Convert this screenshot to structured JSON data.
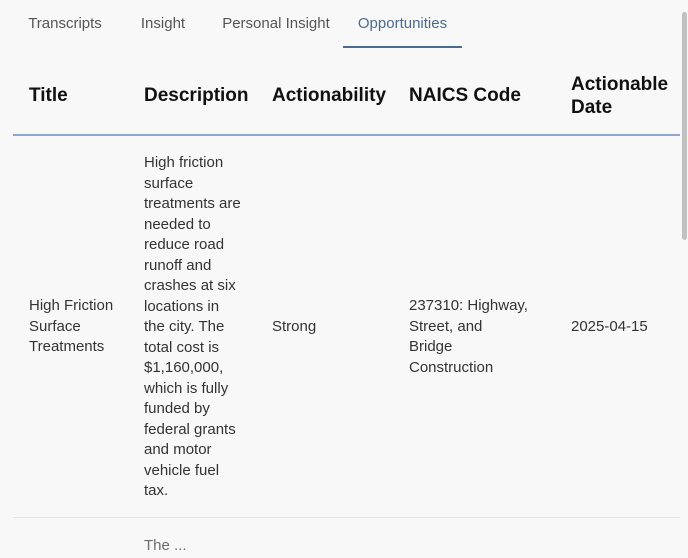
{
  "tabs": [
    "Transcripts",
    "Insight",
    "Personal Insight",
    "Opportunities"
  ],
  "table": {
    "headers": [
      "Title",
      "Description",
      "Actionability",
      "NAICS Code",
      "Actionable Date"
    ],
    "rows": [
      {
        "title": "High Friction Surface Treatments",
        "description": "High friction surface treatments are needed to reduce road runoff and crashes at six locations in the city. The total cost is $1,160,000, which is fully funded by federal grants and motor vehicle fuel tax.",
        "actionability": "Strong",
        "naics": "237310: Highway, Street, and Bridge Construction",
        "date": "2025-04-15"
      },
      {
        "description": "The ..."
      }
    ]
  }
}
